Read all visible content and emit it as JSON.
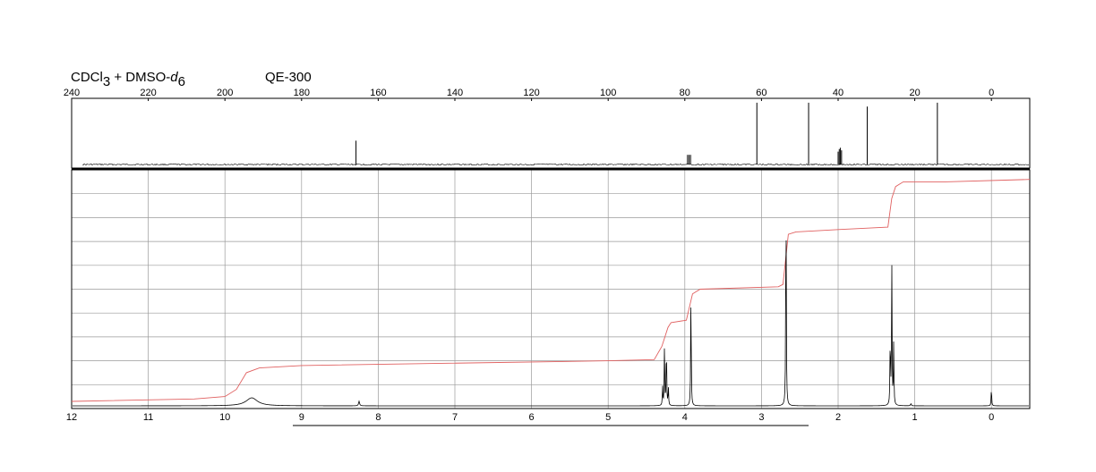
{
  "header": {
    "solvent": "CDCl",
    "solvent_sub": "3",
    "solvent_plus": " + DMSO-",
    "solvent_d": "d",
    "solvent_d_sub": "6",
    "instrument": "QE-300"
  },
  "colors": {
    "trace": "#000000",
    "integral": "#e06060",
    "grid": "#9a9a9a",
    "frame": "#000000"
  },
  "chart_data": [
    {
      "type": "line",
      "nucleus": "13C",
      "x_ticks": [
        240,
        220,
        200,
        180,
        160,
        140,
        120,
        100,
        80,
        60,
        40,
        20,
        0
      ],
      "xlim": [
        240,
        -10
      ],
      "x_reversed": true,
      "grid": false,
      "peaks": [
        {
          "ppm": 165.8,
          "intensity": 0.37
        },
        {
          "ppm": 79.3,
          "intensity": 0.15
        },
        {
          "ppm": 78.9,
          "intensity": 0.15
        },
        {
          "ppm": 78.5,
          "intensity": 0.15
        },
        {
          "ppm": 61.2,
          "intensity": 0.96
        },
        {
          "ppm": 47.7,
          "intensity": 0.96
        },
        {
          "ppm": 40.0,
          "intensity": 0.2
        },
        {
          "ppm": 39.7,
          "intensity": 0.24
        },
        {
          "ppm": 39.4,
          "intensity": 0.26
        },
        {
          "ppm": 39.1,
          "intensity": 0.22
        },
        {
          "ppm": 32.4,
          "intensity": 0.9
        },
        {
          "ppm": 14.1,
          "intensity": 0.96
        }
      ]
    },
    {
      "type": "line",
      "nucleus": "1H",
      "x_ticks": [
        12,
        11,
        10,
        9,
        8,
        7,
        6,
        5,
        4,
        3,
        2,
        1,
        0
      ],
      "xlim": [
        12,
        -0.5
      ],
      "x_reversed": true,
      "grid": true,
      "peaks": [
        {
          "ppm": 9.65,
          "intensity": 0.035,
          "width": 0.09
        },
        {
          "ppm": 8.25,
          "intensity": 0.02,
          "width": 0.008
        },
        {
          "ppm": 4.29,
          "intensity": 0.08,
          "width": 0.004
        },
        {
          "ppm": 4.265,
          "intensity": 0.27,
          "width": 0.004
        },
        {
          "ppm": 4.24,
          "intensity": 0.27,
          "width": 0.004
        },
        {
          "ppm": 4.215,
          "intensity": 0.08,
          "width": 0.004
        },
        {
          "ppm": 3.92,
          "intensity": 0.51,
          "width": 0.004
        },
        {
          "ppm": 2.68,
          "intensity": 0.99,
          "width": 0.004
        },
        {
          "ppm": 1.32,
          "intensity": 0.3,
          "width": 0.004
        },
        {
          "ppm": 1.3,
          "intensity": 0.63,
          "width": 0.004
        },
        {
          "ppm": 1.275,
          "intensity": 0.27,
          "width": 0.004
        },
        {
          "ppm": 1.05,
          "intensity": 0.01,
          "width": 0.006
        },
        {
          "ppm": 0.0,
          "intensity": 0.08,
          "width": 0.004
        }
      ],
      "integral_curve": [
        [
          12.0,
          0.03
        ],
        [
          10.4,
          0.04
        ],
        [
          10.0,
          0.05
        ],
        [
          9.85,
          0.08
        ],
        [
          9.72,
          0.15
        ],
        [
          9.55,
          0.17
        ],
        [
          9.0,
          0.18
        ],
        [
          5.0,
          0.2
        ],
        [
          4.4,
          0.205
        ],
        [
          4.3,
          0.26
        ],
        [
          4.22,
          0.34
        ],
        [
          4.18,
          0.36
        ],
        [
          3.98,
          0.37
        ],
        [
          3.9,
          0.48
        ],
        [
          3.8,
          0.5
        ],
        [
          2.78,
          0.51
        ],
        [
          2.72,
          0.52
        ],
        [
          2.65,
          0.73
        ],
        [
          2.55,
          0.74
        ],
        [
          2.0,
          0.75
        ],
        [
          1.35,
          0.76
        ],
        [
          1.3,
          0.88
        ],
        [
          1.25,
          0.93
        ],
        [
          1.15,
          0.95
        ],
        [
          0.6,
          0.95
        ],
        [
          -0.5,
          0.96
        ]
      ]
    }
  ]
}
